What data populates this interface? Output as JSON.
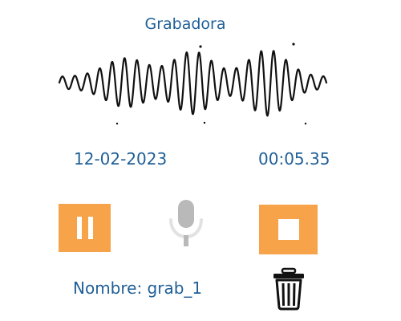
{
  "app": {
    "title": "Grabadora"
  },
  "recording": {
    "date": "12-02-2023",
    "elapsed": "00:05.35",
    "name_label": "Nombre: grab_1"
  },
  "controls": {
    "pause_icon": "pause-icon",
    "mic_icon": "microphone-icon",
    "stop_icon": "stop-icon",
    "delete_icon": "trash-icon"
  },
  "colors": {
    "accent": "#f6a34a",
    "text": "#1f5f97",
    "mic": "#b9b9b9",
    "waveform": "#111111"
  }
}
